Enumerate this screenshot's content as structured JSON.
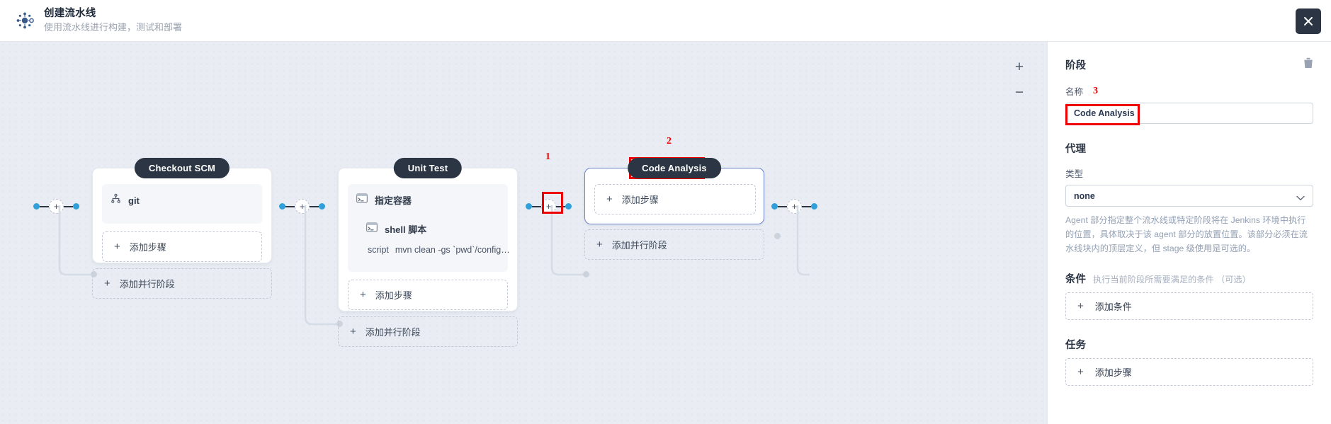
{
  "header": {
    "logo_icon": "pipeline-node-icon",
    "title": "创建流水线",
    "subtitle": "使用流水线进行构建，测试和部署",
    "close_icon": "close-icon"
  },
  "canvas": {
    "zoom_in_label": "+",
    "zoom_out_label": "−",
    "add_step_label": "添加步骤",
    "add_parallel_label": "添加并行阶段",
    "plus_node_label": "+",
    "stages": [
      {
        "name": "Checkout SCM",
        "selected": false,
        "steps": [
          {
            "icon": "git-branch-icon",
            "label": "git",
            "detail": null
          }
        ]
      },
      {
        "name": "Unit Test",
        "selected": false,
        "steps": [
          {
            "icon": "terminal-icon",
            "label": "指定容器",
            "detail": null
          },
          {
            "icon": "terminal-icon",
            "label": "shell 脚本",
            "detail_key": "script",
            "detail": "mvn clean -gs `pwd`/config…"
          }
        ]
      },
      {
        "name": "Code Analysis",
        "selected": true,
        "steps": []
      }
    ]
  },
  "annotations": [
    {
      "number": "1",
      "target": "add-stage-plus-connector"
    },
    {
      "number": "2",
      "target": "code-analysis-stage-label"
    },
    {
      "number": "3",
      "target": "stage-name-input"
    }
  ],
  "panel": {
    "title": "阶段",
    "delete_icon": "trash-icon",
    "name_label": "名称",
    "name_value": "Code Analysis",
    "name_placeholder": "",
    "agent_title": "代理",
    "agent_type_label": "类型",
    "agent_type_value": "none",
    "agent_type_options": [
      "none"
    ],
    "agent_help": "Agent 部分指定整个流水线或特定阶段将在 Jenkins 环境中执行的位置，具体取决于该 agent 部分的放置位置。该部分必须在流水线块内的顶层定义，但 stage 级使用是可选的。",
    "conditions_title": "条件",
    "conditions_hint": "执行当前阶段所需要满足的条件 （可选）",
    "add_condition_label": "添加条件",
    "tasks_title": "任务",
    "add_step_label": "添加步骤",
    "plus_glyph": "+"
  },
  "colors": {
    "accent_blue": "#31a0da",
    "dark_navy": "#2b3544",
    "annotation_red": "#ee0000",
    "selected_border": "#6b7fd1",
    "canvas_bg": "#e9edf3"
  }
}
